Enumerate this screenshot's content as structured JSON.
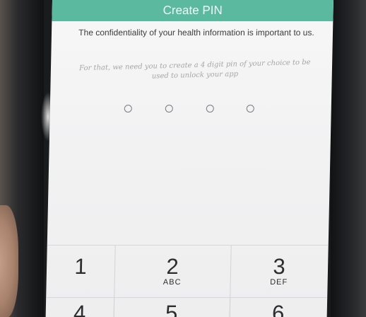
{
  "header": {
    "title": "Create PIN"
  },
  "intro": {
    "line": "The confidentiality of your health information is important to us."
  },
  "note": {
    "line": "For that, we need you to create a 4 digit pin of your choice to be used to unlock your app"
  },
  "pin": {
    "length": 4,
    "entered": 0
  },
  "keypad": {
    "row1": [
      {
        "digit": "1",
        "letters": ""
      },
      {
        "digit": "2",
        "letters": "ABC"
      },
      {
        "digit": "3",
        "letters": "DEF"
      }
    ],
    "row2_partial": [
      {
        "digit": "4"
      },
      {
        "digit": "5"
      },
      {
        "digit": "6"
      }
    ]
  },
  "colors": {
    "header_bg": "#5bb9a0",
    "screen_bg": "#f4f4f5",
    "text_dark": "#3b3d40",
    "text_muted": "#a6a6a9"
  }
}
